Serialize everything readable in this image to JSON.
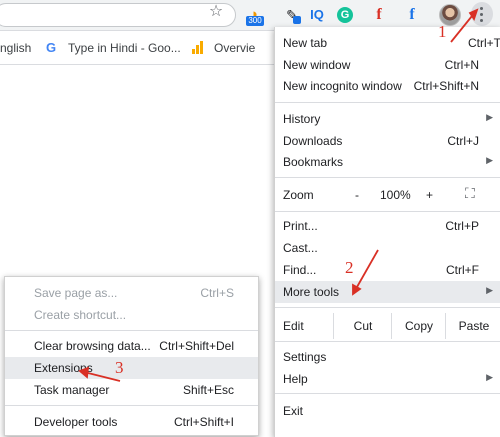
{
  "colors": {
    "accent_red": "#d93025",
    "highlight": "#e8eaed",
    "separator": "#dadce0",
    "disabled_text": "#9aa0a6"
  },
  "toolbar": {
    "bookmark_star_icon": "star-icon",
    "extension_badge": "300",
    "extensions": [
      {
        "name": "rss-icon"
      },
      {
        "name": "color-picker-icon"
      },
      {
        "name": "iq-icon",
        "text": "IQ"
      },
      {
        "name": "grammarly-icon",
        "text": "G"
      },
      {
        "name": "font-icon",
        "text": "f"
      },
      {
        "name": "facebook-icon",
        "text": "f"
      }
    ],
    "menu_icon": "three-dots-icon"
  },
  "bookmarks": {
    "english": "nglish",
    "hindi": "Type in Hindi - Goo...",
    "google_icon": "G",
    "overview": "Overvie"
  },
  "menu": {
    "new_tab": {
      "label": "New tab",
      "shortcut": "Ctrl+T"
    },
    "new_window": {
      "label": "New window",
      "shortcut": "Ctrl+N"
    },
    "new_incognito": {
      "label": "New incognito window",
      "shortcut": "Ctrl+Shift+N"
    },
    "history": {
      "label": "History"
    },
    "downloads": {
      "label": "Downloads",
      "shortcut": "Ctrl+J"
    },
    "bookmarks": {
      "label": "Bookmarks"
    },
    "zoom": {
      "label": "Zoom",
      "minus": "-",
      "level": "100%",
      "plus": "+"
    },
    "print": {
      "label": "Print...",
      "shortcut": "Ctrl+P"
    },
    "cast": {
      "label": "Cast..."
    },
    "find": {
      "label": "Find...",
      "shortcut": "Ctrl+F"
    },
    "more_tools": {
      "label": "More tools"
    },
    "edit": {
      "label": "Edit",
      "cut": "Cut",
      "copy": "Copy",
      "paste": "Paste"
    },
    "settings": {
      "label": "Settings"
    },
    "help": {
      "label": "Help"
    },
    "exit": {
      "label": "Exit"
    }
  },
  "submenu": {
    "save_page": {
      "label": "Save page as...",
      "shortcut": "Ctrl+S"
    },
    "create_shortcut": {
      "label": "Create shortcut..."
    },
    "clear_data": {
      "label": "Clear browsing data...",
      "shortcut": "Ctrl+Shift+Del"
    },
    "extensions": {
      "label": "Extensions"
    },
    "task_manager": {
      "label": "Task manager",
      "shortcut": "Shift+Esc"
    },
    "developer_tools": {
      "label": "Developer tools",
      "shortcut": "Ctrl+Shift+I"
    }
  },
  "annotations": {
    "step1": "1",
    "step2": "2",
    "step3": "3"
  }
}
